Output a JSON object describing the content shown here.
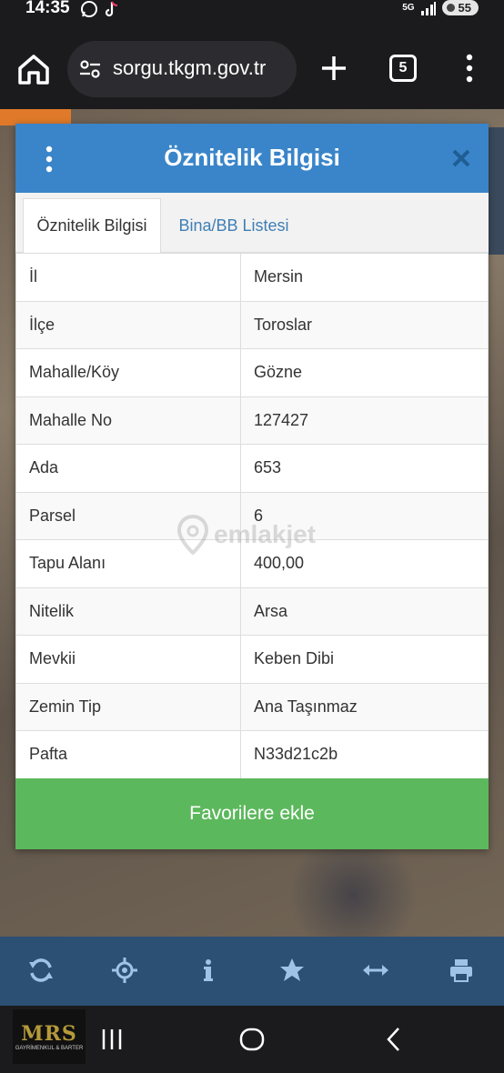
{
  "status_bar": {
    "time": "14:35",
    "network": "5G",
    "battery": "55"
  },
  "browser": {
    "url": "sorgu.tkgm.gov.tr",
    "tab_count": "5"
  },
  "dialog": {
    "title": "Öznitelik Bilgisi",
    "tabs": [
      {
        "label": "Öznitelik Bilgisi",
        "active": true
      },
      {
        "label": "Bina/BB Listesi",
        "active": false
      }
    ],
    "rows": [
      {
        "key": "İl",
        "value": "Mersin"
      },
      {
        "key": "İlçe",
        "value": "Toroslar"
      },
      {
        "key": "Mahalle/Köy",
        "value": "Gözne"
      },
      {
        "key": "Mahalle No",
        "value": "127427"
      },
      {
        "key": "Ada",
        "value": "653"
      },
      {
        "key": "Parsel",
        "value": "6"
      },
      {
        "key": "Tapu Alanı",
        "value": "400,00"
      },
      {
        "key": "Nitelik",
        "value": "Arsa"
      },
      {
        "key": "Mevkii",
        "value": "Keben Dibi"
      },
      {
        "key": "Zemin Tip",
        "value": "Ana Taşınmaz"
      },
      {
        "key": "Pafta",
        "value": "N33d21c2b"
      }
    ],
    "favorite_button": "Favorilere ekle"
  },
  "watermark": "emlakjet",
  "toolbar_icons": [
    "refresh-icon",
    "locate-icon",
    "info-icon",
    "star-icon",
    "measure-icon",
    "print-icon"
  ],
  "brand": {
    "name": "MRS",
    "subtitle": "GAYRİMENKUL & BARTER"
  },
  "colors": {
    "header": "#3a85c9",
    "favorite": "#5cb85c",
    "toolbar": "#2c4f74",
    "tab_link": "#3f7fb5"
  }
}
